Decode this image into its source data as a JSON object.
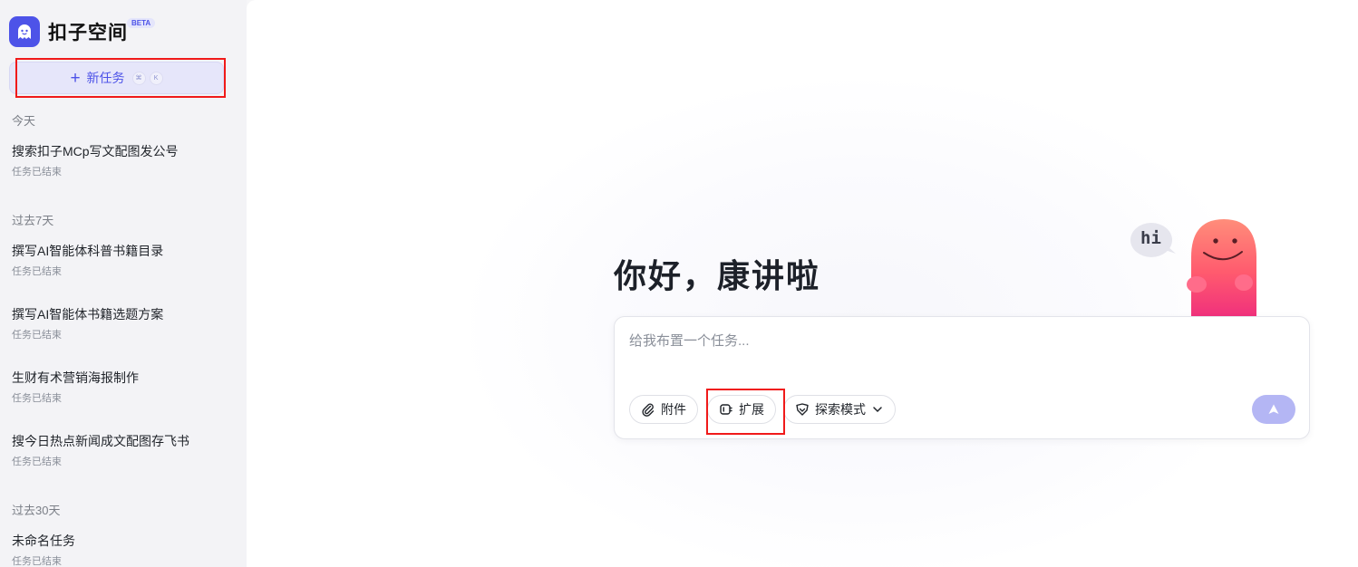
{
  "sidebar": {
    "brand": {
      "name": "扣子空间",
      "badge": "BETA",
      "icon": "ghost-logo-icon"
    },
    "new_task": {
      "label": "新任务",
      "icon": "plus-icon",
      "shortcut": [
        "⌘",
        "K"
      ]
    },
    "groups": [
      {
        "label": "今天",
        "items": [
          {
            "title": "搜索扣子MCp写文配图发公号",
            "status": "任务已结束"
          }
        ]
      },
      {
        "label": "过去7天",
        "items": [
          {
            "title": "撰写AI智能体科普书籍目录",
            "status": "任务已结束"
          },
          {
            "title": "撰写AI智能体书籍选题方案",
            "status": "任务已结束"
          },
          {
            "title": "生财有术营销海报制作",
            "status": "任务已结束"
          },
          {
            "title": "搜今日热点新闻成文配图存飞书",
            "status": "任务已结束"
          }
        ]
      },
      {
        "label": "过去30天",
        "items": [
          {
            "title": "未命名任务",
            "status": "任务已结束"
          }
        ]
      }
    ]
  },
  "main": {
    "greeting": "你好，康讲啦",
    "mascot": {
      "bubble_text": "hi",
      "icon": "pink-mascot-icon"
    },
    "composer": {
      "placeholder": "给我布置一个任务...",
      "value": "",
      "attach_label": "附件",
      "extend_label": "扩展",
      "mode_label": "探索模式",
      "attach_icon": "paperclip-icon",
      "extend_icon": "extension-icon",
      "mode_icon": "tag-icon",
      "send_icon": "send-arrow-icon"
    }
  },
  "colors": {
    "accent": "#4d53e8",
    "send_button": "#b4b6f4",
    "annotation": "#f01a1a"
  }
}
